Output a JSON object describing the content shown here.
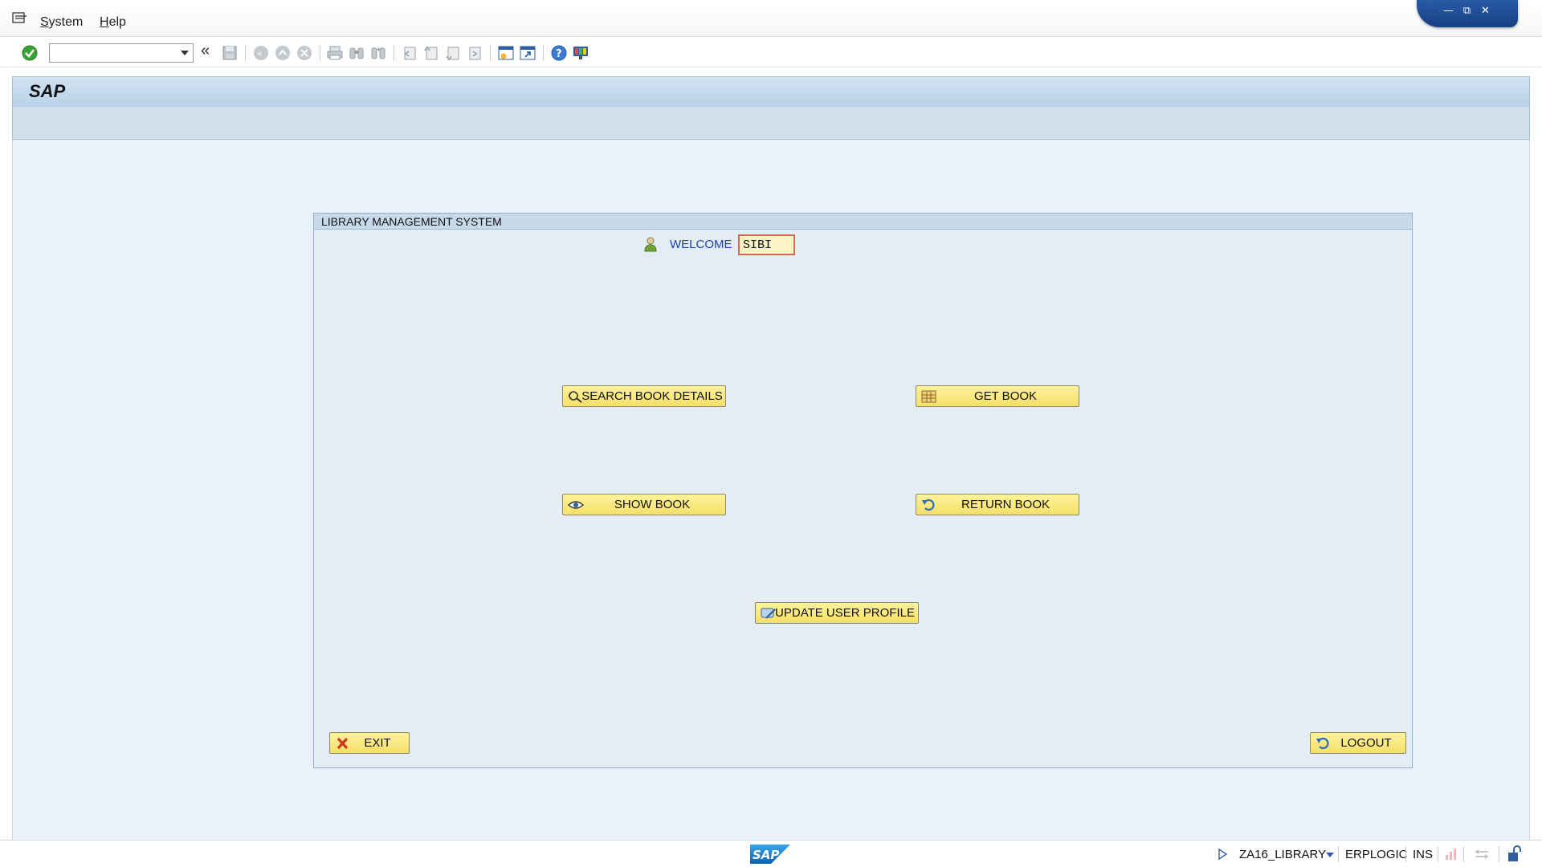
{
  "menubar": {
    "items": [
      {
        "label": "System",
        "mnemonic": "S",
        "rest": "ystem"
      },
      {
        "label": "Help",
        "mnemonic": "H",
        "rest": "elp"
      }
    ]
  },
  "toolbar": {
    "command_field": {
      "value": "",
      "placeholder": ""
    },
    "icons": [
      "enter-icon",
      "back-arrows-icon",
      "save-icon",
      "back-icon",
      "exit-icon",
      "cancel-icon",
      "print-icon",
      "find-icon",
      "find-next-icon",
      "first-page-icon",
      "previous-page-icon",
      "next-page-icon",
      "last-page-icon",
      "create-session-icon",
      "shortcut-icon",
      "help-icon",
      "customize-layout-icon"
    ]
  },
  "title": "SAP",
  "frame": {
    "title": "LIBRARY MANAGEMENT SYSTEM",
    "welcome_label": "WELCOME",
    "welcome_value": "SIBI"
  },
  "buttons": {
    "search": "SEARCH BOOK DETAILS",
    "get": "GET BOOK",
    "show": "SHOW BOOK",
    "return": "RETURN BOOK",
    "update": "UPDATE USER PROFILE",
    "exit": "EXIT",
    "logout": "LOGOUT"
  },
  "statusbar": {
    "logo_text": "SAP",
    "program": "ZA16_LIBRARY",
    "server": "ERPLOGIC",
    "mode": "INS"
  },
  "colors": {
    "button_bg": "#f8e87a",
    "title_bg": "#c7daea",
    "workarea_bg": "#eaf1f8",
    "welcome_text": "#1a3fb8",
    "window_controls": "#1f4d94"
  }
}
